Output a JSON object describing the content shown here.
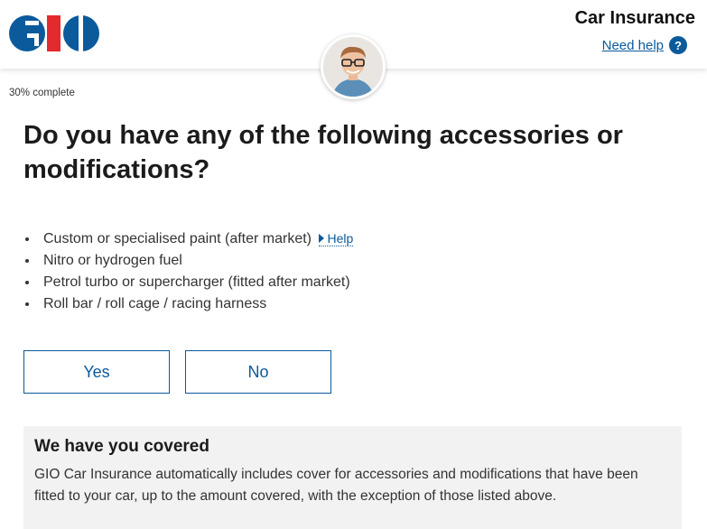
{
  "header": {
    "product_title": "Car Insurance",
    "need_help": "Need help",
    "help_icon_glyph": "?",
    "logo_letters": "GIO",
    "brand_blue": "#0a5a9c",
    "brand_red": "#e32a2e"
  },
  "progress": {
    "text": "30% complete",
    "percent": 30
  },
  "question": {
    "title": "Do you have any of the following accessories or modifications?"
  },
  "items": [
    {
      "label": "Custom or specialised paint (after market)",
      "help": "Help"
    },
    {
      "label": "Nitro or hydrogen fuel"
    },
    {
      "label": "Petrol turbo or supercharger (fitted after market)"
    },
    {
      "label": "Roll bar / roll cage / racing harness"
    }
  ],
  "choices": {
    "yes": "Yes",
    "no": "No"
  },
  "info": {
    "title": "We have you covered",
    "text": "GIO Car Insurance automatically includes cover for accessories and modifications that have been fitted to your car, up to the amount covered, with the exception of those listed above."
  },
  "icons": {
    "logo": "gio-logo",
    "avatar": "agent-avatar",
    "help": "question-icon",
    "help_arrow": "triangle-right-icon"
  }
}
